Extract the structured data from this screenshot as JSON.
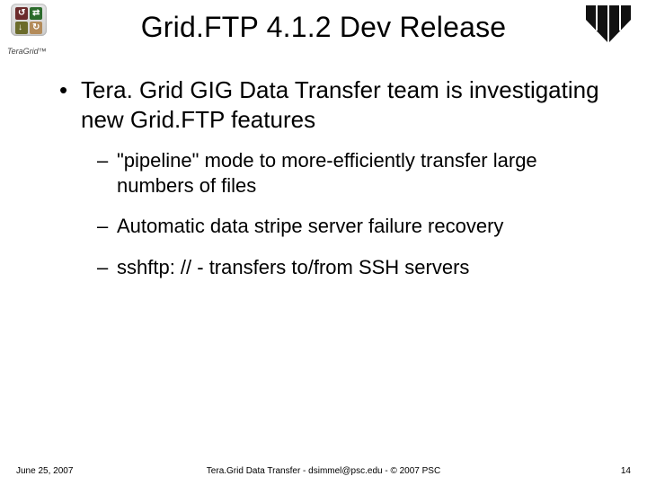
{
  "title": "Grid.FTP 4.1.2 Dev Release",
  "logo": {
    "left_label": "TeraGrid™"
  },
  "bullets": {
    "main": "Tera. Grid GIG Data Transfer team is investigating new Grid.FTP features",
    "sub": [
      "\"pipeline\" mode to more-efficiently transfer large numbers of files",
      "Automatic data stripe server failure recovery",
      "sshftp: // - transfers to/from SSH servers"
    ]
  },
  "footer": {
    "date": "June 25, 2007",
    "center": "Tera.Grid Data Transfer - dsimmel@psc.edu - © 2007 PSC",
    "page": "14"
  }
}
